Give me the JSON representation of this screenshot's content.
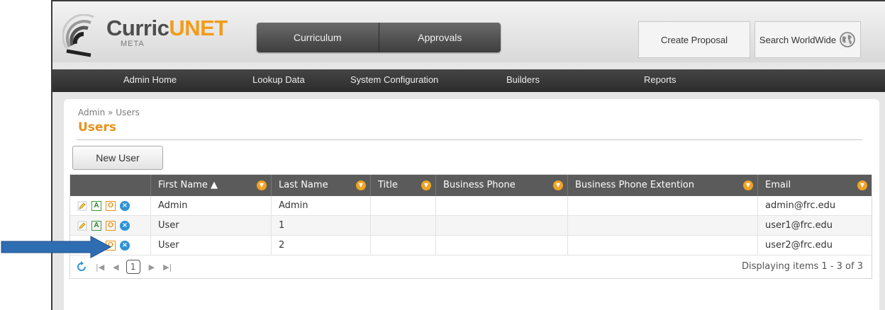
{
  "logo": {
    "brand_part1": "Curric",
    "brand_part2": "UNET",
    "sub": "META"
  },
  "topnav": {
    "tabs": [
      {
        "label": "Curriculum"
      },
      {
        "label": "Approvals"
      }
    ]
  },
  "header_buttons": {
    "create_proposal": "Create Proposal",
    "search_worldwide": "Search WorldWide",
    "search_icon": "globe-icon"
  },
  "menubar": {
    "items": [
      {
        "label": "Admin Home"
      },
      {
        "label": "Lookup Data"
      },
      {
        "label": "System Configuration"
      },
      {
        "label": "Builders"
      },
      {
        "label": "Reports"
      }
    ]
  },
  "breadcrumb": "Admin » Users",
  "page_title": "Users",
  "new_user_label": "New User",
  "grid": {
    "columns": [
      "",
      "First Name ▲",
      "Last Name",
      "Title",
      "Business Phone",
      "Business Phone Extention",
      "Email"
    ],
    "action_icons": {
      "edit": "pencil-icon",
      "assign": "A",
      "other": "O",
      "delete": "x-circle-icon"
    },
    "rows": [
      {
        "first": "Admin",
        "last": "Admin",
        "title": "",
        "phone": "",
        "ext": "",
        "email": "admin@frc.edu",
        "show_edit": true
      },
      {
        "first": "User",
        "last": "1",
        "title": "",
        "phone": "",
        "ext": "",
        "email": "user1@frc.edu",
        "show_edit": true
      },
      {
        "first": "User",
        "last": "2",
        "title": "",
        "phone": "",
        "ext": "",
        "email": "user2@frc.edu",
        "show_edit": false
      }
    ]
  },
  "pager": {
    "current_page": "1",
    "info": "Displaying items 1 - 3 of 3"
  },
  "colors": {
    "accent": "#e8921c",
    "arrow": "#2f6db3",
    "grid_header": "#5b5b5b"
  }
}
